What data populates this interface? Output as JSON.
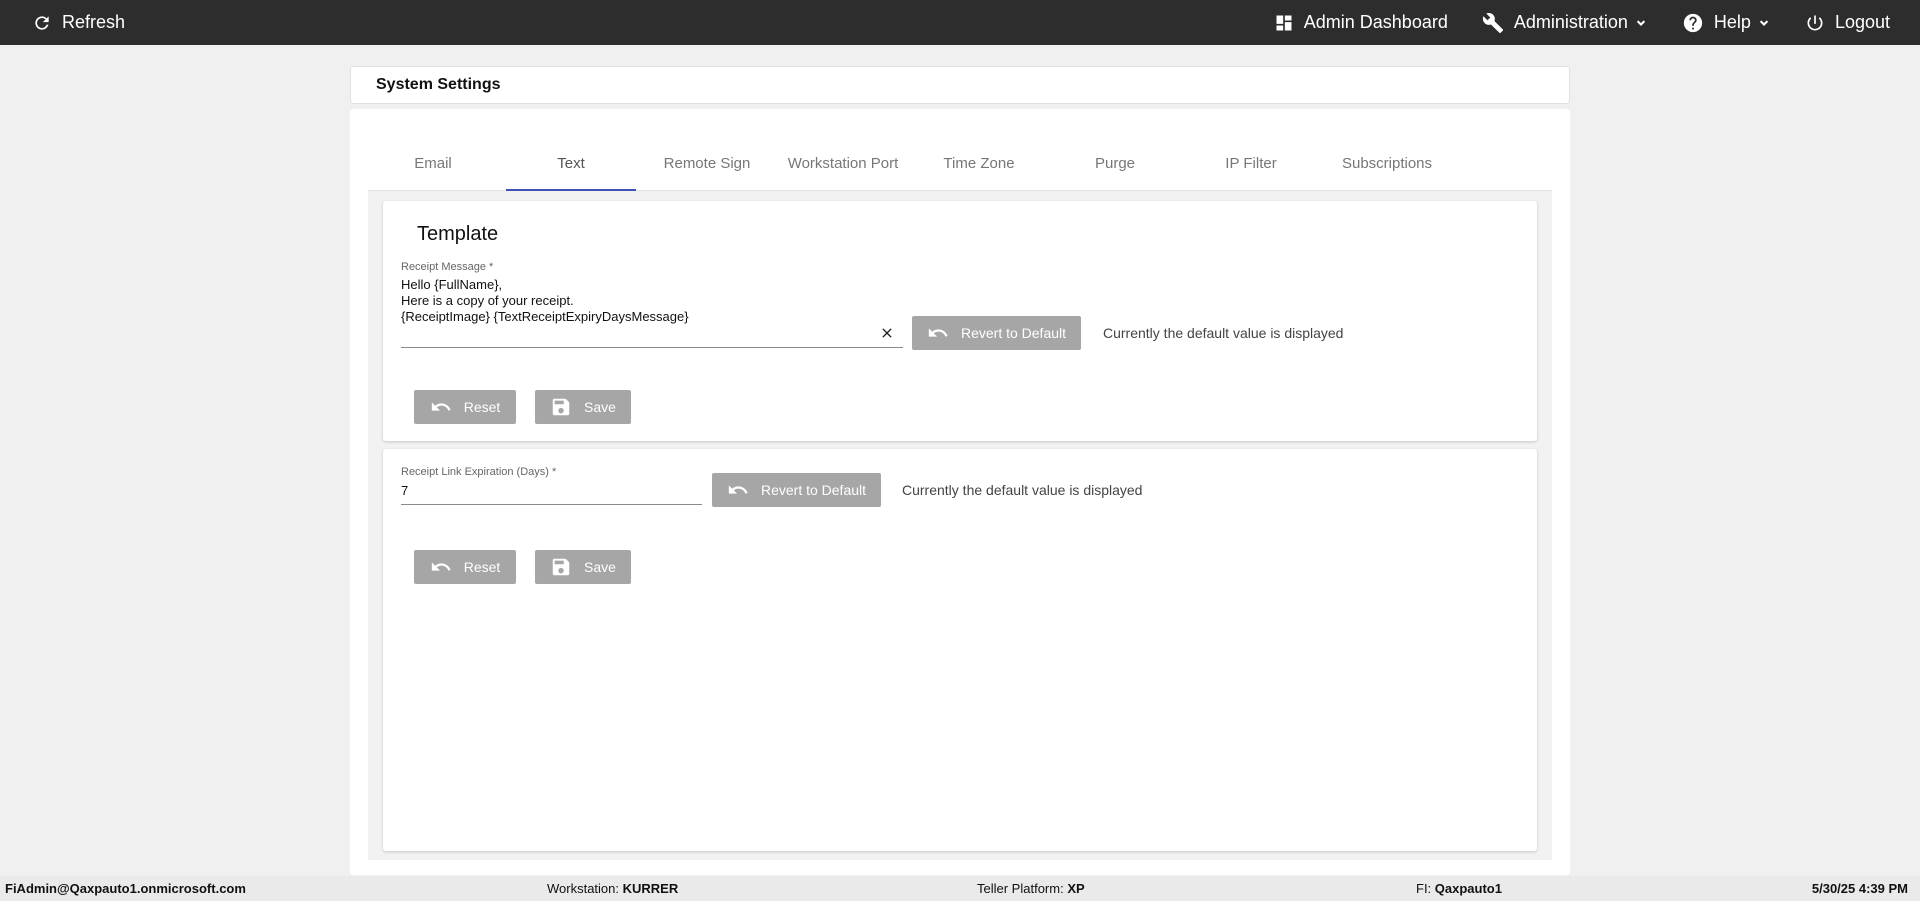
{
  "topbar": {
    "refresh_label": "Refresh",
    "admin_dashboard_label": "Admin Dashboard",
    "administration_label": "Administration",
    "help_label": "Help",
    "logout_label": "Logout"
  },
  "page": {
    "title": "System Settings"
  },
  "tabs": [
    {
      "label": "Email"
    },
    {
      "label": "Text"
    },
    {
      "label": "Remote Sign"
    },
    {
      "label": "Workstation Port"
    },
    {
      "label": "Time Zone"
    },
    {
      "label": "Purge"
    },
    {
      "label": "IP Filter"
    },
    {
      "label": "Subscriptions"
    }
  ],
  "active_tab": "Text",
  "template_panel": {
    "title": "Template",
    "receipt_message": {
      "label": "Receipt Message *",
      "value": "Hello {FullName},\nHere is a copy of your receipt.\n{ReceiptImage} {TextReceiptExpiryDaysMessage}"
    },
    "revert_label": "Revert to Default",
    "status": "Currently the default value is displayed",
    "reset_label": "Reset",
    "save_label": "Save"
  },
  "expiration_panel": {
    "receipt_link_expiration": {
      "label": "Receipt Link Expiration (Days) *",
      "value": "7"
    },
    "revert_label": "Revert to Default",
    "status": "Currently the default value is displayed",
    "reset_label": "Reset",
    "save_label": "Save"
  },
  "footer": {
    "user": "FiAdmin@Qaxpauto1.onmicrosoft.com",
    "workstation_label": "Workstation: ",
    "workstation_value": "KURRER",
    "teller_platform_label": "Teller Platform: ",
    "teller_platform_value": "XP",
    "fi_label": "FI: ",
    "fi_value": "Qaxpauto1",
    "datetime": "5/30/25 4:39 PM"
  },
  "colors": {
    "topbar_bg": "#2d2d2d",
    "active_tab_indicator": "#3f51b5",
    "button_bg": "#a6a6a6"
  }
}
